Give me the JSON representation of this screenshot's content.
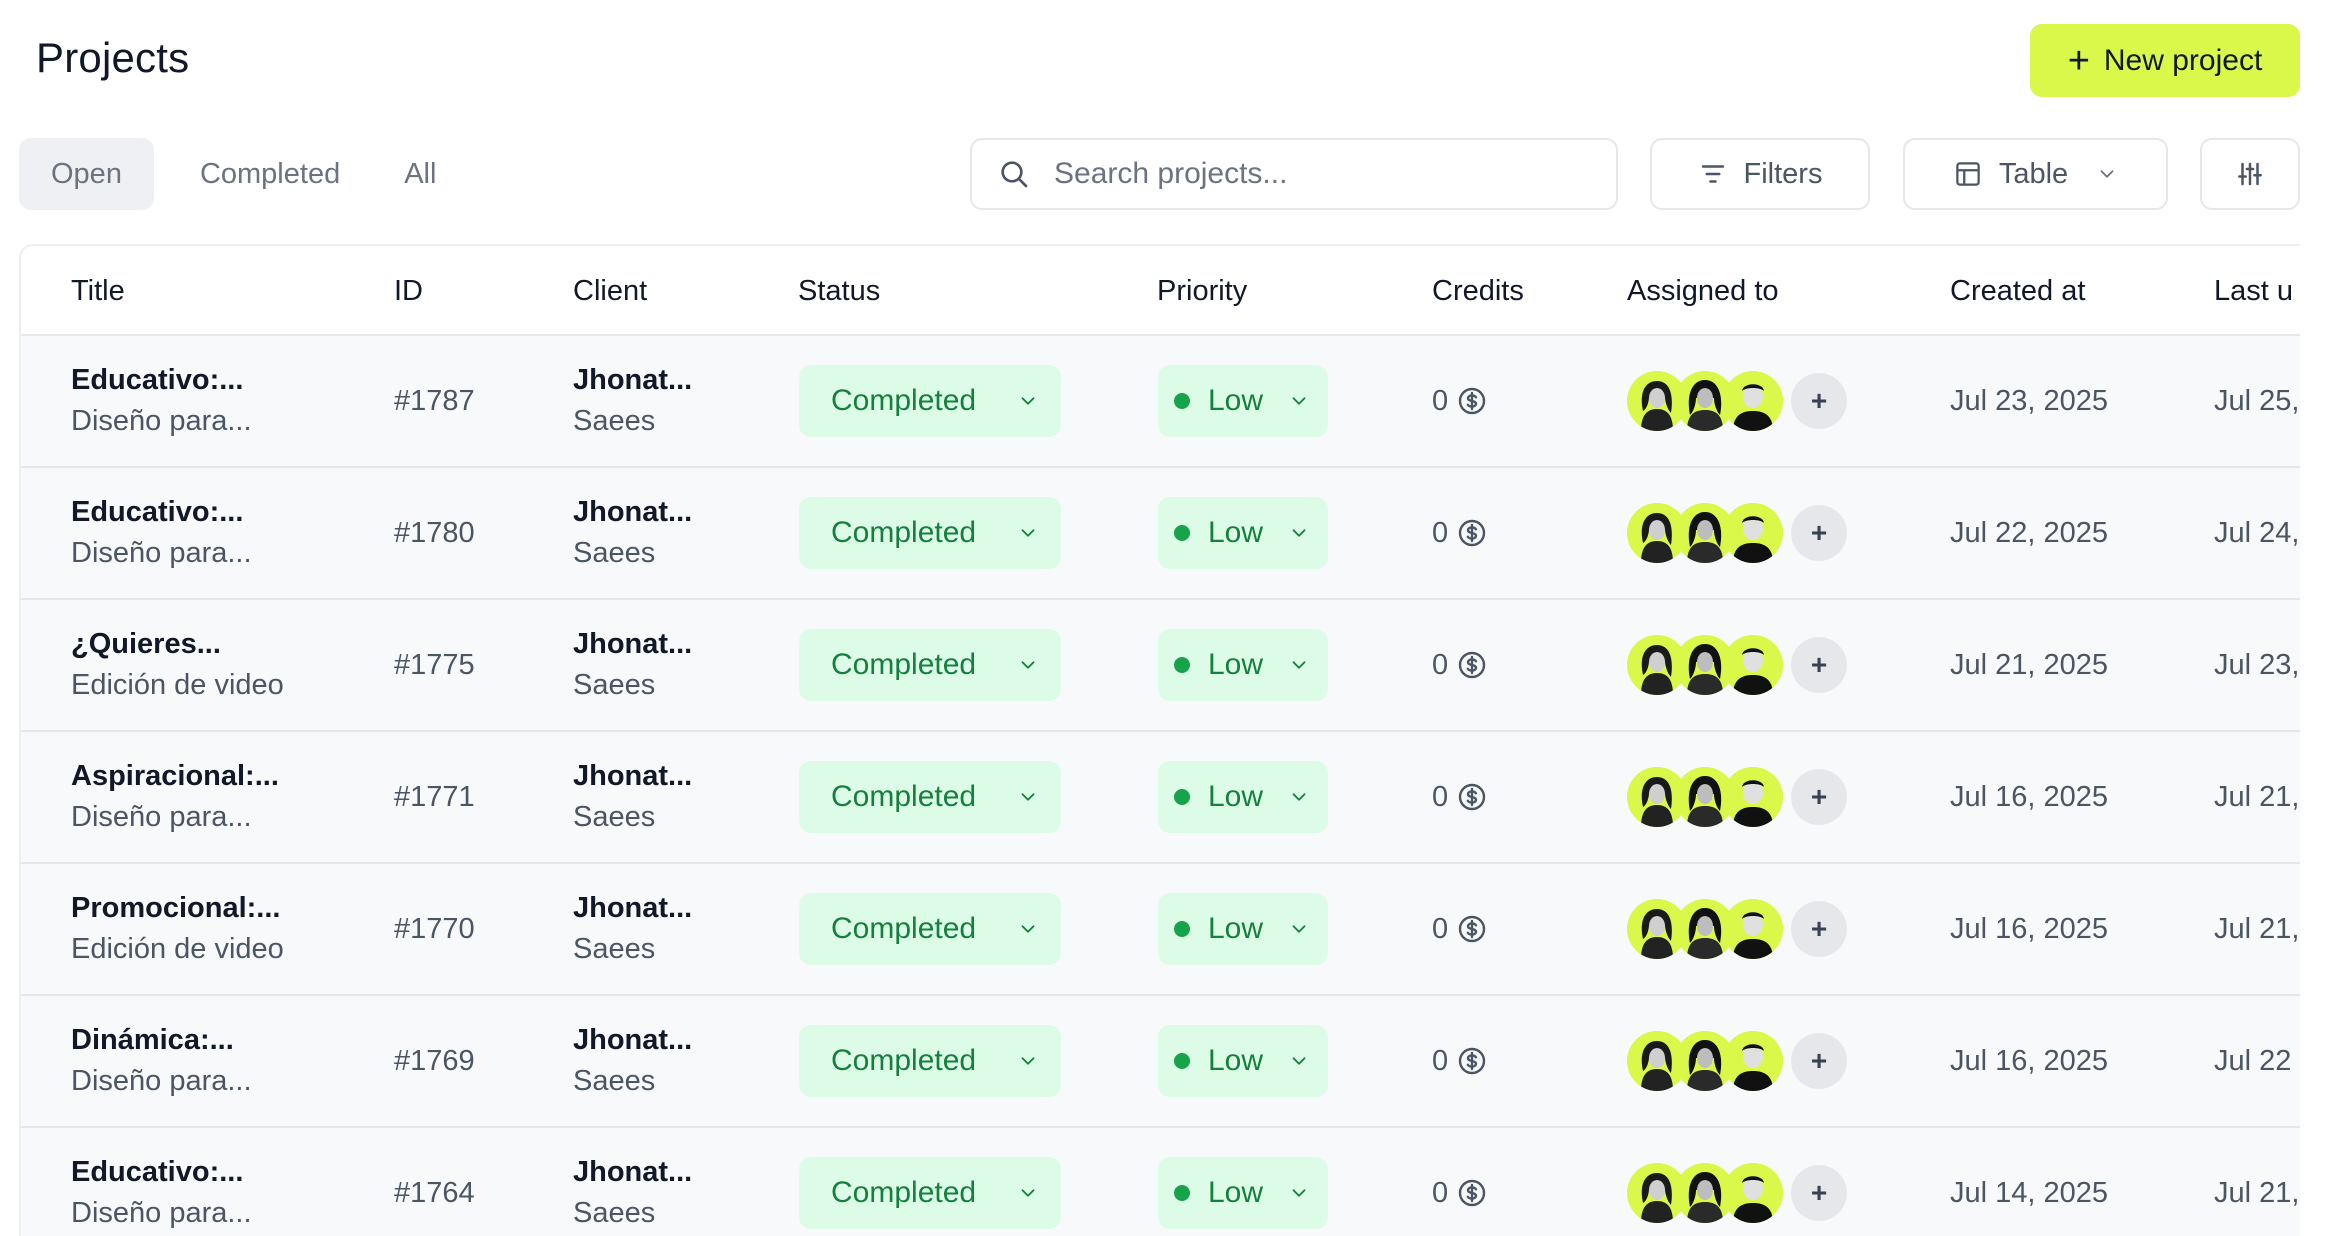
{
  "header": {
    "title": "Projects",
    "new_project_label": "New project"
  },
  "tabs": [
    {
      "label": "Open",
      "active": true
    },
    {
      "label": "Completed",
      "active": false
    },
    {
      "label": "All",
      "active": false
    }
  ],
  "search": {
    "placeholder": "Search projects...",
    "value": ""
  },
  "toolbar": {
    "filters_label": "Filters",
    "view_label": "Table"
  },
  "table": {
    "columns": [
      "Title",
      "ID",
      "Client",
      "Status",
      "Priority",
      "Credits",
      "Assigned to",
      "Created at",
      "Last u"
    ],
    "rows": [
      {
        "title": "Educativo:...",
        "subtitle": "Diseño para...",
        "id": "#1787",
        "client": "Jhonat...",
        "client_sub": "Saees",
        "status": "Completed",
        "priority": "Low",
        "credits": "0",
        "add": "+",
        "created": "Jul 23, 2025",
        "updated": "Jul 25,"
      },
      {
        "title": "Educativo:...",
        "subtitle": "Diseño para...",
        "id": "#1780",
        "client": "Jhonat...",
        "client_sub": "Saees",
        "status": "Completed",
        "priority": "Low",
        "credits": "0",
        "add": "+",
        "created": "Jul 22, 2025",
        "updated": "Jul 24,"
      },
      {
        "title": "¿Quieres...",
        "subtitle": "Edición de video",
        "id": "#1775",
        "client": "Jhonat...",
        "client_sub": "Saees",
        "status": "Completed",
        "priority": "Low",
        "credits": "0",
        "add": "+",
        "created": "Jul 21, 2025",
        "updated": "Jul 23,"
      },
      {
        "title": "Aspiracional:...",
        "subtitle": "Diseño para...",
        "id": "#1771",
        "client": "Jhonat...",
        "client_sub": "Saees",
        "status": "Completed",
        "priority": "Low",
        "credits": "0",
        "add": "+",
        "created": "Jul 16, 2025",
        "updated": "Jul 21,"
      },
      {
        "title": "Promocional:...",
        "subtitle": "Edición de video",
        "id": "#1770",
        "client": "Jhonat...",
        "client_sub": "Saees",
        "status": "Completed",
        "priority": "Low",
        "credits": "0",
        "add": "+",
        "created": "Jul 16, 2025",
        "updated": "Jul 21,"
      },
      {
        "title": "Dinámica:...",
        "subtitle": "Diseño para...",
        "id": "#1769",
        "client": "Jhonat...",
        "client_sub": "Saees",
        "status": "Completed",
        "priority": "Low",
        "credits": "0",
        "add": "+",
        "created": "Jul 16, 2025",
        "updated": "Jul 22"
      },
      {
        "title": "Educativo:...",
        "subtitle": "Diseño para...",
        "id": "#1764",
        "client": "Jhonat...",
        "client_sub": "Saees",
        "status": "Completed",
        "priority": "Low",
        "credits": "0",
        "add": "+",
        "created": "Jul 14, 2025",
        "updated": "Jul 21,"
      }
    ]
  },
  "icons": {
    "search": "search-icon",
    "filter": "filter-icon",
    "table": "table-icon",
    "settings": "sliders-icon",
    "chevron": "chevron-down-icon",
    "credit": "dollar-coin-icon",
    "plus": "plus-icon"
  },
  "colors": {
    "accent": "#d9f84a",
    "status_bg": "#dcfce7",
    "status_text": "#15803d",
    "priority_dot": "#16a34a"
  }
}
